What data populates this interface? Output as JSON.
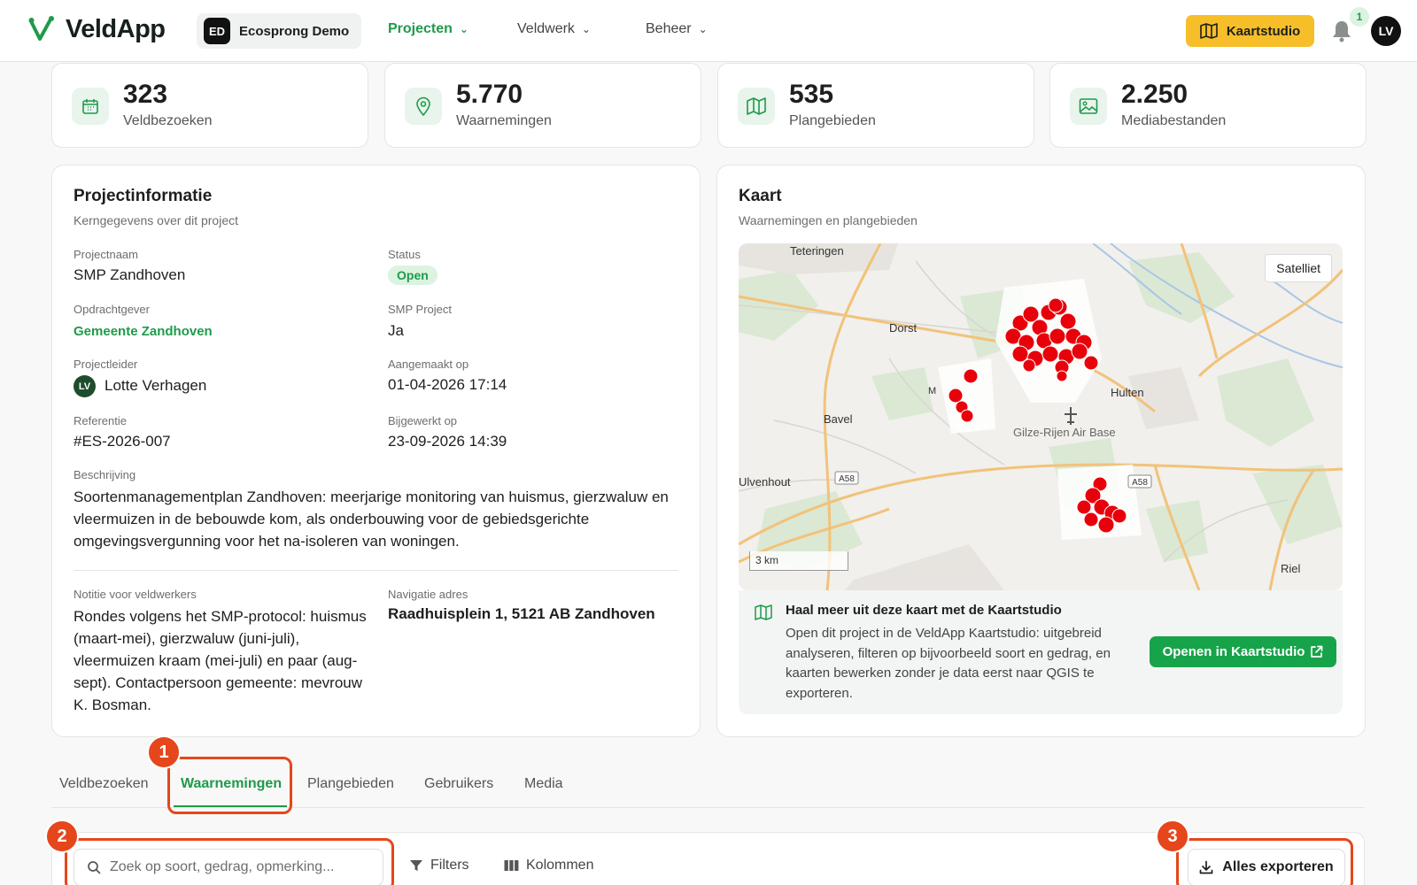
{
  "nav": {
    "logo_text": "VeldApp",
    "org_badge": "ED",
    "org_name": "Ecosprong Demo",
    "links": [
      "Projecten",
      "Veldwerk",
      "Beheer"
    ],
    "kaartstudio": "Kaartstudio",
    "notifications_count": "1",
    "user_initials": "LV"
  },
  "stats": [
    {
      "value": "323",
      "label": "Veldbezoeken",
      "icon": "calendar-icon"
    },
    {
      "value": "5.770",
      "label": "Waarnemingen",
      "icon": "map-pin-icon"
    },
    {
      "value": "535",
      "label": "Plangebieden",
      "icon": "map-icon"
    },
    {
      "value": "2.250",
      "label": "Mediabestanden",
      "icon": "image-icon"
    }
  ],
  "project": {
    "title": "Projectinformatie",
    "subtitle": "Kerngegevens over dit project",
    "name_label": "Projectnaam",
    "name": "SMP Zandhoven",
    "status_label": "Status",
    "status": "Open",
    "client_label": "Opdrachtgever",
    "client": "Gemeente Zandhoven",
    "smp_label": "SMP Project",
    "smp": "Ja",
    "leader_label": "Projectleider",
    "leader_initials": "LV",
    "leader": "Lotte Verhagen",
    "created_label": "Aangemaakt op",
    "created": "01-04-2026 17:14",
    "reference_label": "Referentie",
    "reference": "#ES-2026-007",
    "updated_label": "Bijgewerkt op",
    "updated": "23-09-2026 14:39",
    "description_label": "Beschrijving",
    "description": "Soortenmanagementplan Zandhoven: meerjarige monitoring van huismus, gierzwaluw en vleermuizen in de bebouwde kom, als onderbouwing voor de gebiedsgerichte omgevingsvergunning voor het na-isoleren van woningen.",
    "note_label": "Notitie voor veldwerkers",
    "note": "Rondes volgens het SMP-protocol: huismus (maart-mei), gierzwaluw (juni-juli), vleermuizen kraam (mei-juli) en paar (aug-sept). Contactpersoon gemeente: mevrouw K. Bosman.",
    "nav_label": "Navigatie adres",
    "nav_address": "Raadhuisplein 1, 5121 AB Zandhoven"
  },
  "map": {
    "title": "Kaart",
    "subtitle": "Waarnemingen en plangebieden",
    "satellite": "Satelliet",
    "scale": "3 km",
    "places": [
      "Teteringen",
      "Dorst",
      "Hulten",
      "Bavel",
      "Gilze-Rijen Air Base",
      "Ulvenhout",
      "Riel",
      "M"
    ],
    "roads": [
      "A58",
      "A58"
    ],
    "promo_title": "Haal meer uit deze kaart met de Kaartstudio",
    "promo_text": "Open dit project in de VeldApp Kaartstudio: uitgebreid analyseren, filteren op bijvoorbeeld soort en gedrag, en kaarten bewerken zonder je data eerst naar QGIS te exporteren.",
    "promo_button": "Openen in Kaartstudio"
  },
  "tabs": [
    "Veldbezoeken",
    "Waarnemingen",
    "Plangebieden",
    "Gebruikers",
    "Media"
  ],
  "active_tab": "Waarnemingen",
  "toolbar": {
    "search_placeholder": "Zoek op soort, gedrag, opmerking...",
    "filters": "Filters",
    "columns": "Kolommen",
    "export": "Alles exporteren"
  },
  "annotations": [
    "1",
    "2",
    "3"
  ],
  "colors": {
    "accent": "#1f9a4a",
    "kaartstudio": "#f6bf2a",
    "annotation": "#e6461b",
    "marker": "#e8000a"
  }
}
